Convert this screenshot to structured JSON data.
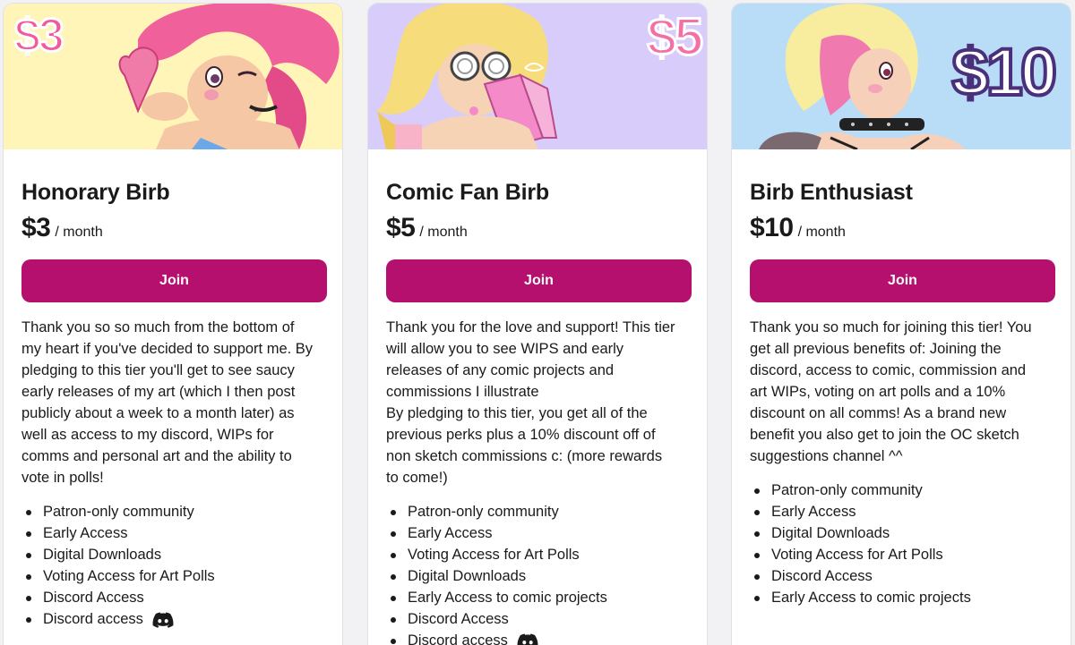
{
  "tiers": [
    {
      "banner_price": "$3",
      "banner_color": "#fff5b8",
      "name": "Honorary Birb",
      "price": "$3",
      "period": "/ month",
      "join_label": "Join",
      "description": "Thank you so so much from the bottom of\nmy heart if you've decided to support me. By\npledging to this tier you'll get to see saucy\nearly releases of my art (which I then post\npublicly about a week to a month later) as\nwell as access to my discord, WIPs for\ncomms and personal art and the ability to\nvote in polls!",
      "benefits": [
        "Patron-only community",
        "Early Access",
        "Digital Downloads",
        "Voting Access for Art Polls",
        "Discord Access",
        "Discord access"
      ]
    },
    {
      "banner_price": "$5",
      "banner_color": "#d8ccfa",
      "name": "Comic Fan Birb",
      "price": "$5",
      "period": "/ month",
      "join_label": "Join",
      "description": "Thank you for the love and support! This tier\nwill allow you to see WIPS and early\nreleases of any comic projects and\ncommissions I illustrate\nBy pledging to this tier, you get all of the\nprevious perks plus a 10% discount off of\nnon sketch commissions c: (more rewards\nto come!)",
      "benefits": [
        "Patron-only community",
        "Early Access",
        "Voting Access for Art Polls",
        "Digital Downloads",
        "Early Access to comic projects",
        "Discord Access",
        "Discord access"
      ]
    },
    {
      "banner_price": "$10",
      "banner_color": "#b9dcf7",
      "name": "Birb Enthusiast",
      "price": "$10",
      "period": "/ month",
      "join_label": "Join",
      "description": "Thank you so much for joining this tier! You\nget all previous benefits of: Joining the\ndiscord, access to comic, commission and\nart WIPs, voting on art polls and a 10%\ndiscount on all comms! As a brand new\nbenefit you also get to join the OC sketch\nsuggestions channel ^^",
      "benefits": [
        "Patron-only community",
        "Early Access",
        "Digital Downloads",
        "Voting Access for Art Polls",
        "Discord Access",
        "Early Access to comic projects"
      ]
    }
  ],
  "colors": {
    "join_button": "#b5106e",
    "price_badge_pink": "#f25a9a",
    "price_badge_purple": "#4a2f7a"
  },
  "icons": {
    "discord": "discord-icon"
  }
}
